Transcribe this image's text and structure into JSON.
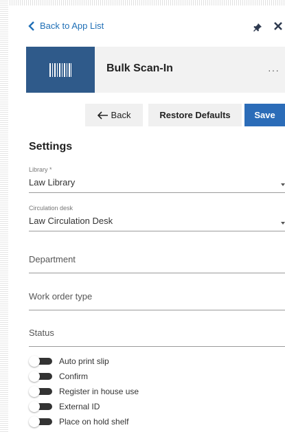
{
  "nav": {
    "back_link_label": "Back to App List"
  },
  "app": {
    "title": "Bulk Scan-In",
    "more_label": "···"
  },
  "toolbar": {
    "back_label": "Back",
    "restore_label": "Restore Defaults",
    "save_label": "Save"
  },
  "settings": {
    "title": "Settings",
    "library": {
      "label": "Library *",
      "value": "Law Library"
    },
    "circulation_desk": {
      "label": "Circulation desk",
      "value": "Law Circulation Desk"
    },
    "department": {
      "placeholder": "Department"
    },
    "work_order_type": {
      "placeholder": "Work order type"
    },
    "status": {
      "placeholder": "Status"
    },
    "toggles": [
      {
        "label": "Auto print slip",
        "on": false
      },
      {
        "label": "Confirm",
        "on": false
      },
      {
        "label": "Register in house use",
        "on": false
      },
      {
        "label": "External ID",
        "on": false
      },
      {
        "label": "Place on hold shelf",
        "on": false
      }
    ]
  },
  "colors": {
    "accent": "#2b6cb8",
    "link": "#1f6fb6",
    "logo_bg": "#2f5a8a",
    "header_bg": "#f2f2f2"
  },
  "icons": [
    "chevron-left-icon",
    "pin-icon",
    "close-icon",
    "barcode-icon",
    "more-icon",
    "arrow-left-icon",
    "dropdown-arrow-icon"
  ]
}
